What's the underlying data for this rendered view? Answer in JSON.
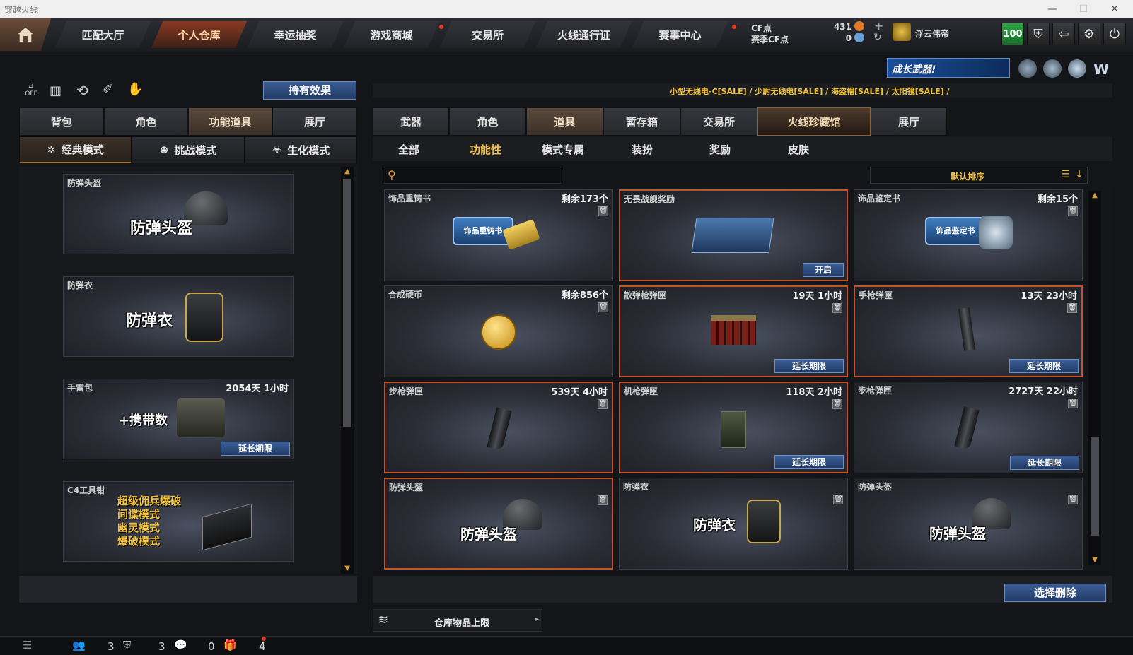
{
  "window": {
    "title": "穿越火线"
  },
  "topnav": {
    "tabs": [
      "匹配大厅",
      "个人仓库",
      "幸运抽奖",
      "游戏商城",
      "交易所",
      "火线通行证",
      "赛事中心"
    ],
    "cf_label": "CF点",
    "season_cf_label": "赛季CF点",
    "cf_value": "431",
    "season_cf_value": "0",
    "username": "浮云伟帝",
    "level_badge": "100"
  },
  "banner": {
    "text": "成长武器!"
  },
  "ticker": "小型无线电-C[SALE] / 少尉无线电[SALE] / 海盗帽[SALE] / 太阳镜[SALE] /",
  "left": {
    "toggle_label": "OFF",
    "effects_button": "持有效果",
    "tabs": [
      "背包",
      "角色",
      "功能道具",
      "展厅"
    ],
    "modes": [
      "经典模式",
      "挑战模式",
      "生化模式"
    ],
    "items": [
      {
        "name": "防弹头盔",
        "big": "防弹头盔",
        "time": ""
      },
      {
        "name": "防弹衣",
        "big": "防弹衣",
        "time": ""
      },
      {
        "name": "手雷包",
        "big": "+携带数",
        "time": "2054天 1小时",
        "extend": "延长期限"
      },
      {
        "name": "C4工具钳",
        "lines": [
          "超级佣兵爆破",
          "间谍模式",
          "幽灵模式",
          "爆破模式"
        ]
      }
    ]
  },
  "right": {
    "tabs": [
      "武器",
      "角色",
      "道具",
      "暂存箱",
      "交易所",
      "火线珍藏馆",
      "展厅"
    ],
    "subtabs": [
      "全部",
      "功能性",
      "模式专属",
      "装扮",
      "奖励",
      "皮肤"
    ],
    "sort_label": "默认排序",
    "items": [
      {
        "name": "饰品重铸书",
        "right": "剩余173个",
        "art": "饰品重铸书"
      },
      {
        "name": "无畏战舰奖励",
        "right": "",
        "action": "开启"
      },
      {
        "name": "饰品鉴定书",
        "right": "剩余15个",
        "art": "饰品鉴定书"
      },
      {
        "name": "合成硬币",
        "right": "剩余856个"
      },
      {
        "name": "散弹枪弹匣",
        "right": "19天 1小时",
        "action": "延长期限"
      },
      {
        "name": "手枪弹匣",
        "right": "13天 23小时",
        "action": "延长期限"
      },
      {
        "name": "步枪弹匣",
        "right": "539天 4小时"
      },
      {
        "name": "机枪弹匣",
        "right": "118天 2小时",
        "action": "延长期限"
      },
      {
        "name": "步枪弹匣",
        "right": "2727天 22小时",
        "action": "延长期限"
      },
      {
        "name": "防弹头盔",
        "right": "",
        "big": "防弹头盔"
      },
      {
        "name": "防弹衣",
        "right": "",
        "big": "防弹衣"
      },
      {
        "name": "防弹头盔",
        "right": "",
        "big": "防弹头盔"
      }
    ],
    "delete_button": "选择删除",
    "capacity_label": "仓库物品上限"
  },
  "statusbar": {
    "counts": [
      "3",
      "3",
      "0",
      "4"
    ]
  },
  "colors": {
    "accent": "#c2532a",
    "ticker": "#f0c030",
    "blue_button": "#2f5189"
  }
}
